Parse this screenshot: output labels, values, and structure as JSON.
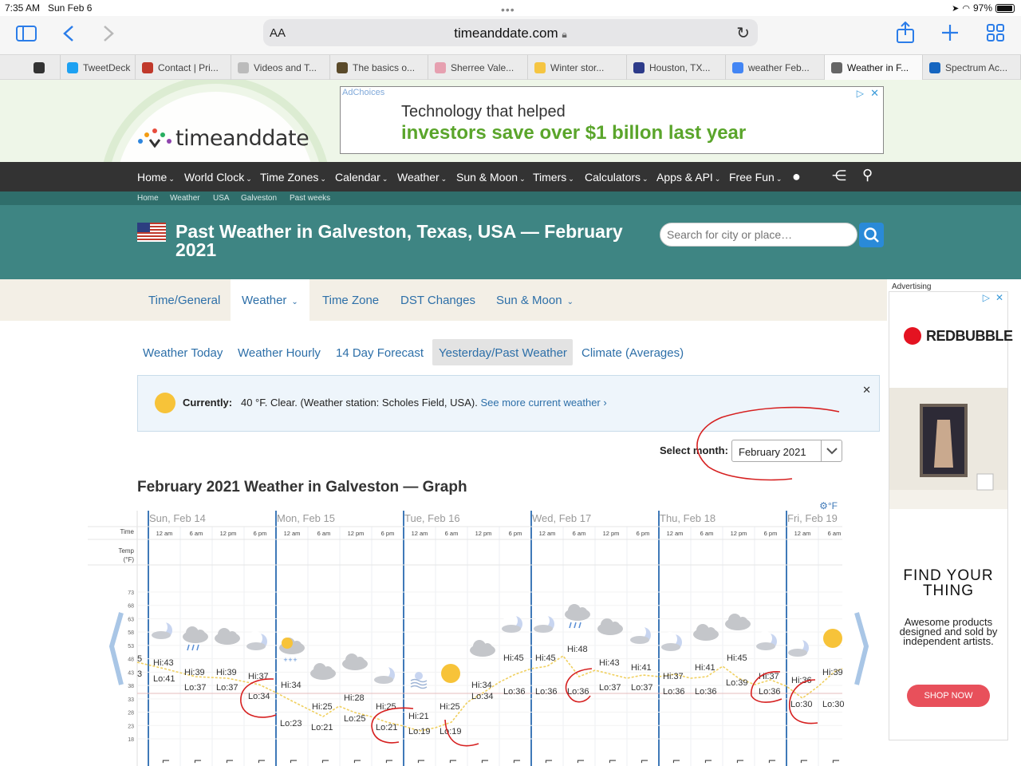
{
  "status_bar": {
    "time": "7:35 AM",
    "date": "Sun Feb 6",
    "battery": "97%"
  },
  "browser": {
    "text_size_label": "AA",
    "url": "timeanddate.com"
  },
  "tabs": [
    {
      "label": "",
      "color": "#333"
    },
    {
      "label": "TweetDeck",
      "color": "#1da1f2"
    },
    {
      "label": "Contact | Pri...",
      "color": "#c0392b"
    },
    {
      "label": "Videos and T...",
      "color": "#bbbbbb"
    },
    {
      "label": "The basics o...",
      "color": "#5a4a2a"
    },
    {
      "label": "Sherree Vale...",
      "color": "#e6a0b0"
    },
    {
      "label": "Winter stor...",
      "color": "#f5c542"
    },
    {
      "label": "Houston, TX...",
      "color": "#2d3b8a"
    },
    {
      "label": "weather Feb...",
      "color": "#4285f4"
    },
    {
      "label": "Weather in F...",
      "color": "#666"
    },
    {
      "label": "Spectrum Ac...",
      "color": "#1565c0"
    }
  ],
  "site": {
    "logo": "timeanddate"
  },
  "ad_banner": {
    "adchoices": "AdChoices",
    "line1": "Technology that helped",
    "line2": "investors save over $1 billon last year"
  },
  "nav": {
    "items": [
      "Home",
      "World Clock",
      "Time Zones",
      "Calendar",
      "Weather",
      "Sun & Moon",
      "Timers",
      "Calculators",
      "Apps & API",
      "Free Fun"
    ]
  },
  "breadcrumbs": [
    "Home",
    "Weather",
    "USA",
    "Galveston",
    "Past weeks"
  ],
  "page": {
    "title": "Past Weather in Galveston, Texas, USA — February 2021",
    "search_placeholder": "Search for city or place…"
  },
  "subnav": {
    "items": [
      "Time/General",
      "Weather",
      "Time Zone",
      "DST Changes",
      "Sun & Moon"
    ]
  },
  "weather_nav": {
    "items": [
      "Weather Today",
      "Weather Hourly",
      "14 Day Forecast",
      "Yesterday/Past Weather",
      "Climate (Averages)"
    ]
  },
  "current": {
    "label": "Currently:",
    "text": "40 °F. Clear. (Weather station: Scholes Field, USA).",
    "link": "See more current weather"
  },
  "month_select": {
    "label": "Select month:",
    "value": "February 2021"
  },
  "graph": {
    "title": "February 2021 Weather in Galveston — Graph",
    "unit": "°F",
    "time_label": "Time",
    "temp_label": "Temp (°F)",
    "days": [
      "Sun, Feb 14",
      "Mon, Feb 15",
      "Tue, Feb 16",
      "Wed, Feb 17",
      "Thu, Feb 18",
      "Fri, Feb 19"
    ],
    "times": [
      "12 am",
      "6 am",
      "12 pm",
      "6 pm"
    ],
    "y_ticks": [
      73,
      68,
      63,
      58,
      53,
      48,
      43,
      38,
      33,
      28,
      23,
      18
    ],
    "labels": [
      {
        "t": "Hi:43",
        "x": 192,
        "y": 834
      },
      {
        "t": "Lo:41",
        "x": 192,
        "y": 854
      },
      {
        "t": "Hi:39",
        "x": 231,
        "y": 846
      },
      {
        "t": "Lo:37",
        "x": 231,
        "y": 865
      },
      {
        "t": "Hi:39",
        "x": 271,
        "y": 846
      },
      {
        "t": "Lo:37",
        "x": 271,
        "y": 865
      },
      {
        "t": "Hi:37",
        "x": 311,
        "y": 851
      },
      {
        "t": "Lo:34",
        "x": 311,
        "y": 876
      },
      {
        "t": "Hi:34",
        "x": 352,
        "y": 862
      },
      {
        "t": "Lo:23",
        "x": 351,
        "y": 910
      },
      {
        "t": "Hi:25",
        "x": 391,
        "y": 889
      },
      {
        "t": "Lo:21",
        "x": 390,
        "y": 915
      },
      {
        "t": "Hi:28",
        "x": 431,
        "y": 878
      },
      {
        "t": "Lo:25",
        "x": 431,
        "y": 904
      },
      {
        "t": "Hi:25",
        "x": 471,
        "y": 889
      },
      {
        "t": "Lo:21",
        "x": 471,
        "y": 915
      },
      {
        "t": "Hi:21",
        "x": 512,
        "y": 901
      },
      {
        "t": "Lo:19",
        "x": 512,
        "y": 920
      },
      {
        "t": "Hi:25",
        "x": 551,
        "y": 889
      },
      {
        "t": "Lo:19",
        "x": 551,
        "y": 920
      },
      {
        "t": "Hi:34",
        "x": 591,
        "y": 862
      },
      {
        "t": "Lo:34",
        "x": 591,
        "y": 876
      },
      {
        "t": "Hi:45",
        "x": 631,
        "y": 828
      },
      {
        "t": "Lo:36",
        "x": 631,
        "y": 870
      },
      {
        "t": "Hi:45",
        "x": 671,
        "y": 828
      },
      {
        "t": "Lo:36",
        "x": 671,
        "y": 870
      },
      {
        "t": "Hi:48",
        "x": 711,
        "y": 817
      },
      {
        "t": "Lo:36",
        "x": 711,
        "y": 870
      },
      {
        "t": "Hi:43",
        "x": 751,
        "y": 834
      },
      {
        "t": "Lo:37",
        "x": 751,
        "y": 865
      },
      {
        "t": "Hi:41",
        "x": 791,
        "y": 840
      },
      {
        "t": "Lo:37",
        "x": 791,
        "y": 865
      },
      {
        "t": "Hi:37",
        "x": 831,
        "y": 851
      },
      {
        "t": "Lo:36",
        "x": 831,
        "y": 870
      },
      {
        "t": "Hi:41",
        "x": 871,
        "y": 840
      },
      {
        "t": "Lo:36",
        "x": 871,
        "y": 870
      },
      {
        "t": "Hi:45",
        "x": 911,
        "y": 828
      },
      {
        "t": "Lo:39",
        "x": 910,
        "y": 859
      },
      {
        "t": "Hi:37",
        "x": 951,
        "y": 851
      },
      {
        "t": "Lo:36",
        "x": 951,
        "y": 870
      },
      {
        "t": "Hi:36",
        "x": 992,
        "y": 856
      },
      {
        "t": "Lo:30",
        "x": 991,
        "y": 886
      },
      {
        "t": "Hi:39",
        "x": 1031,
        "y": 846
      },
      {
        "t": "Lo:30",
        "x": 1031,
        "y": 886
      }
    ]
  },
  "right_ad": {
    "label": "Advertising",
    "brand": "REDBUBBLE",
    "headline": "FIND YOUR THING",
    "body": "Awesome products designed and sold by independent artists.",
    "cta": "SHOP NOW"
  },
  "colors": {
    "nav_bg": "#333333",
    "title_bg": "#3e8583",
    "link": "#2d6fa8",
    "sun": "#f7c339",
    "annotation": "#d62020"
  }
}
